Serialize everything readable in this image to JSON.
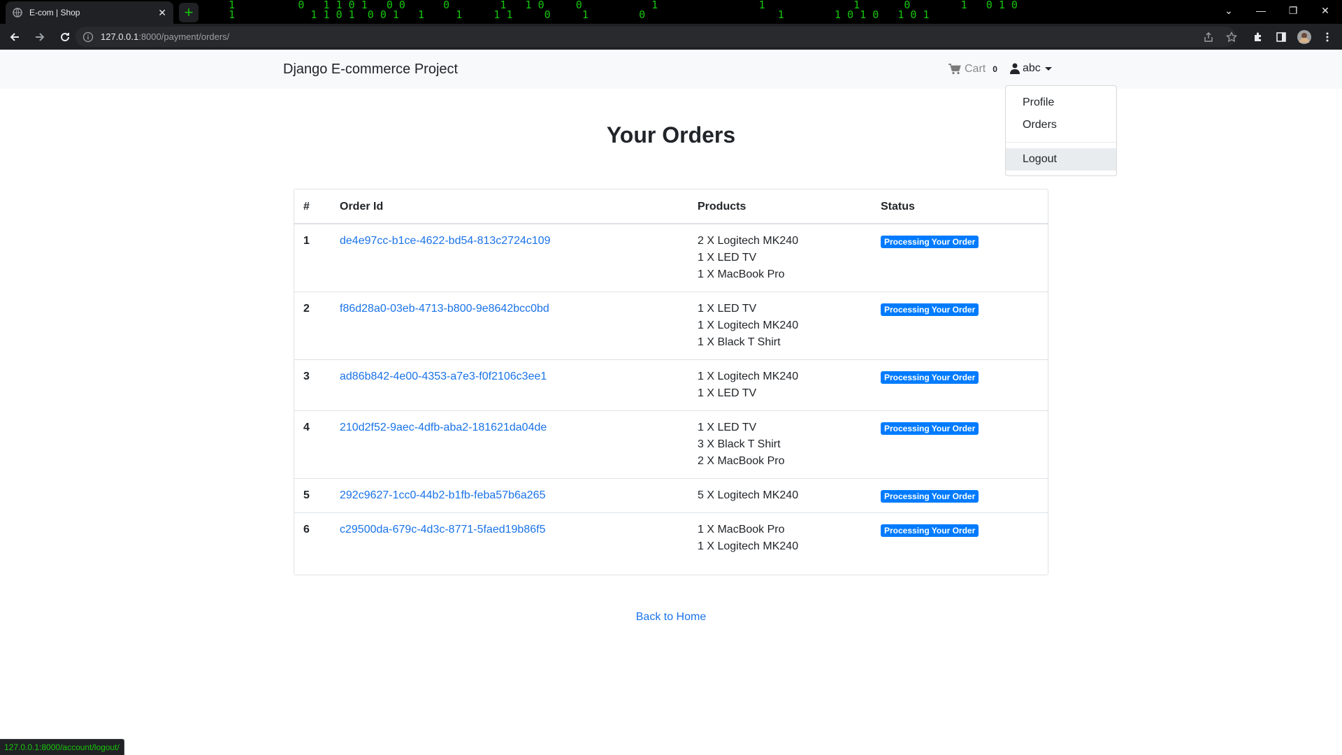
{
  "browser": {
    "tab_title": "E-com | Shop",
    "url_host": "127.0.0.1",
    "url_path": ":8000/payment/orders/",
    "status_url": "127.0.0.1:8000/account/logout/"
  },
  "navbar": {
    "brand": "Django E-commerce Project",
    "cart_label": "Cart",
    "cart_count": "0",
    "user_name": "abc"
  },
  "user_menu": {
    "items": [
      "Profile",
      "Orders"
    ],
    "logout": "Logout"
  },
  "page": {
    "title": "Your Orders",
    "back_link": "Back to Home"
  },
  "table": {
    "headers": [
      "#",
      "Order Id",
      "Products",
      "Status"
    ],
    "rows": [
      {
        "index": "1",
        "order_id": "de4e97cc-b1ce-4622-bd54-813c2724c109",
        "products": [
          "2 X Logitech MK240",
          "1 X LED TV",
          "1 X MacBook Pro"
        ],
        "status": "Processing Your Order"
      },
      {
        "index": "2",
        "order_id": "f86d28a0-03eb-4713-b800-9e8642bcc0bd",
        "products": [
          "1 X LED TV",
          "1 X Logitech MK240",
          "1 X Black T Shirt"
        ],
        "status": "Processing Your Order"
      },
      {
        "index": "3",
        "order_id": "ad86b842-4e00-4353-a7e3-f0f2106c3ee1",
        "products": [
          "1 X Logitech MK240",
          "1 X LED TV"
        ],
        "status": "Processing Your Order"
      },
      {
        "index": "4",
        "order_id": "210d2f52-9aec-4dfb-aba2-181621da04de",
        "products": [
          "1 X LED TV",
          "3 X Black T Shirt",
          "2 X MacBook Pro"
        ],
        "status": "Processing Your Order"
      },
      {
        "index": "5",
        "order_id": "292c9627-1cc0-44b2-b1fb-feba57b6a265",
        "products": [
          "5 X Logitech MK240"
        ],
        "status": "Processing Your Order"
      },
      {
        "index": "6",
        "order_id": "c29500da-679c-4d3c-8771-5faed19b86f5",
        "products": [
          "1 X MacBook Pro",
          "1 X Logitech MK240"
        ],
        "status": "Processing Your Order"
      }
    ]
  },
  "colors": {
    "link": "#1a73e8",
    "badge": "#007bff",
    "navbar_bg": "#f8f9fa",
    "matrix_green": "#16c60c"
  },
  "icons": [
    "globe-favicon-icon",
    "close-icon",
    "plus-icon",
    "back-arrow-icon",
    "forward-arrow-icon",
    "reload-icon",
    "info-icon",
    "share-icon",
    "star-icon",
    "extensions-icon",
    "sidepanel-icon",
    "profile-avatar-icon",
    "menu-dots-icon",
    "cart-icon",
    "user-icon",
    "caret-down-icon",
    "chevron-down-icon",
    "minimize-icon",
    "restore-icon",
    "window-close-icon"
  ]
}
